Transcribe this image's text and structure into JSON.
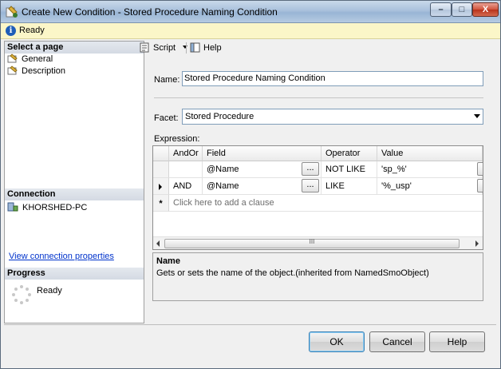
{
  "window": {
    "title": "Create New Condition - Stored Procedure Naming Condition",
    "controls": {
      "minimize": "–",
      "maximize": "□",
      "close": "X"
    }
  },
  "status": {
    "text": "Ready",
    "icon": "info-icon"
  },
  "sidebar": {
    "select_page_header": "Select a page",
    "pages": [
      {
        "label": "General",
        "icon": "page-icon"
      },
      {
        "label": "Description",
        "icon": "page-icon"
      }
    ],
    "connection_header": "Connection",
    "server": "KHORSHED-PC",
    "connection_link": "View connection properties",
    "progress_header": "Progress",
    "progress_text": "Ready"
  },
  "toolbar": {
    "script_label": "Script",
    "help_label": "Help"
  },
  "form": {
    "name_label": "Name:",
    "name_value": "Stored Procedure Naming Condition",
    "facet_label": "Facet:",
    "facet_value": "Stored Procedure",
    "expression_label": "Expression:"
  },
  "grid": {
    "columns": [
      "AndOr",
      "Field",
      "Operator",
      "Value"
    ],
    "ellipsis": "...",
    "rows": [
      {
        "andor": "",
        "field": "@Name",
        "operator": "NOT LIKE",
        "value": "'sp_%'"
      },
      {
        "andor": "AND",
        "field": "@Name",
        "operator": "LIKE",
        "value": "'%_usp'"
      }
    ],
    "new_row_marker": "*",
    "new_row_hint": "Click here to add a clause",
    "scroll_grip": "III"
  },
  "description": {
    "title": "Name",
    "text": "Gets or sets the name of the object.(inherited from NamedSmoObject)"
  },
  "buttons": {
    "ok": "OK",
    "cancel": "Cancel",
    "help": "Help"
  }
}
